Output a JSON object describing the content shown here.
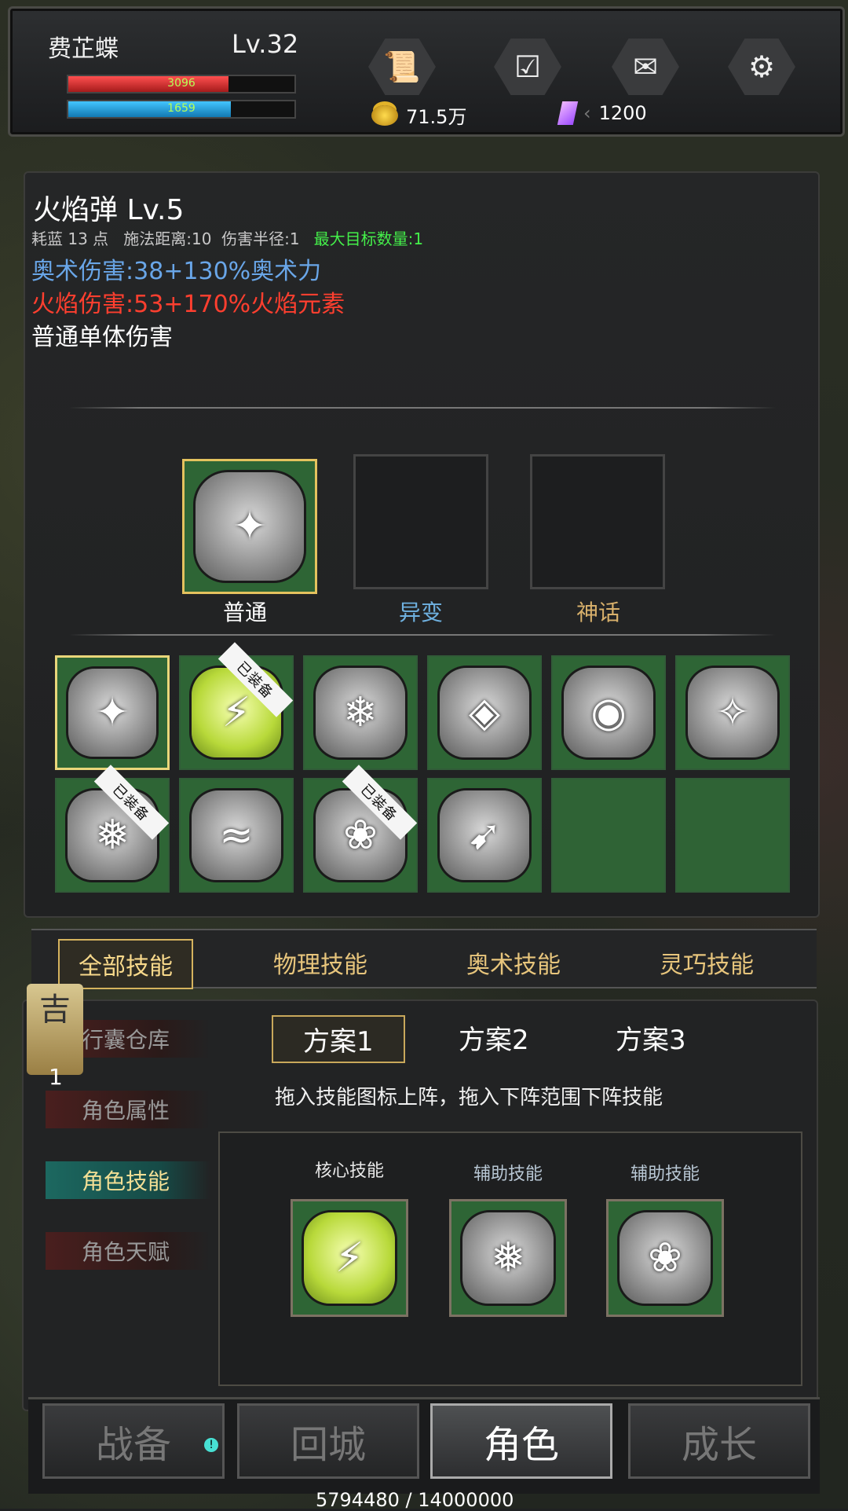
{
  "hud": {
    "name": "费芷蝶",
    "level": "Lv.32",
    "hp": "3096",
    "mp": "1659",
    "hp_fraction": 0.71,
    "mp_fraction": 0.72,
    "gold": "71.5万",
    "gems": "1200",
    "icons": [
      "scroll-icon",
      "calendar-check-icon",
      "mail-icon",
      "gear-icon"
    ]
  },
  "skill": {
    "name": "火焰弹 Lv.5",
    "stats": "耗蓝 13 点   施法距离:10  伤害半径:1",
    "max_targets": "最大目标数量:1",
    "arcane": "奥术伤害:38+130%奥术力",
    "fire": "火焰伤害:53+170%火焰元素",
    "type": "普通单体伤害"
  },
  "variants": [
    {
      "label": "普通",
      "color": "#ffffff"
    },
    {
      "label": "异变",
      "color": "#6fb1e0"
    },
    {
      "label": "神话",
      "color": "#d8b06b"
    }
  ],
  "runes": [
    {
      "glyph": "✦",
      "equipped": false,
      "yellow": false
    },
    {
      "glyph": "⚡",
      "equipped": true,
      "yellow": true
    },
    {
      "glyph": "❄",
      "equipped": false,
      "yellow": false
    },
    {
      "glyph": "◈",
      "equipped": false,
      "yellow": false
    },
    {
      "glyph": "◉",
      "equipped": false,
      "yellow": false
    },
    {
      "glyph": "✧",
      "equipped": false,
      "yellow": false
    },
    {
      "glyph": "❅",
      "equipped": true,
      "yellow": false
    },
    {
      "glyph": "≈",
      "equipped": false,
      "yellow": false
    },
    {
      "glyph": "❀",
      "equipped": true,
      "yellow": false
    },
    {
      "glyph": "➹",
      "equipped": false,
      "yellow": false
    }
  ],
  "equipped_tag": "已装备",
  "filter_tabs": [
    "全部技能",
    "物理技能",
    "奥术技能",
    "灵巧技能"
  ],
  "side_menu": [
    "行囊仓库",
    "角色属性",
    "角色技能",
    "角色天赋"
  ],
  "side_badge": {
    "char": "吉",
    "num": "1"
  },
  "schemes": [
    "方案1",
    "方案2",
    "方案3"
  ],
  "hint": "拖入技能图标上阵，拖入下阵范围下阵技能",
  "loadout": [
    {
      "label": "核心技能",
      "glyph": "⚡",
      "yellow": true
    },
    {
      "label": "辅助技能",
      "glyph": "❅",
      "yellow": false
    },
    {
      "label": "辅助技能",
      "glyph": "❀",
      "yellow": false
    }
  ],
  "nav": [
    "战备",
    "回城",
    "角色",
    "成长"
  ],
  "exp": "5794480 / 14000000"
}
